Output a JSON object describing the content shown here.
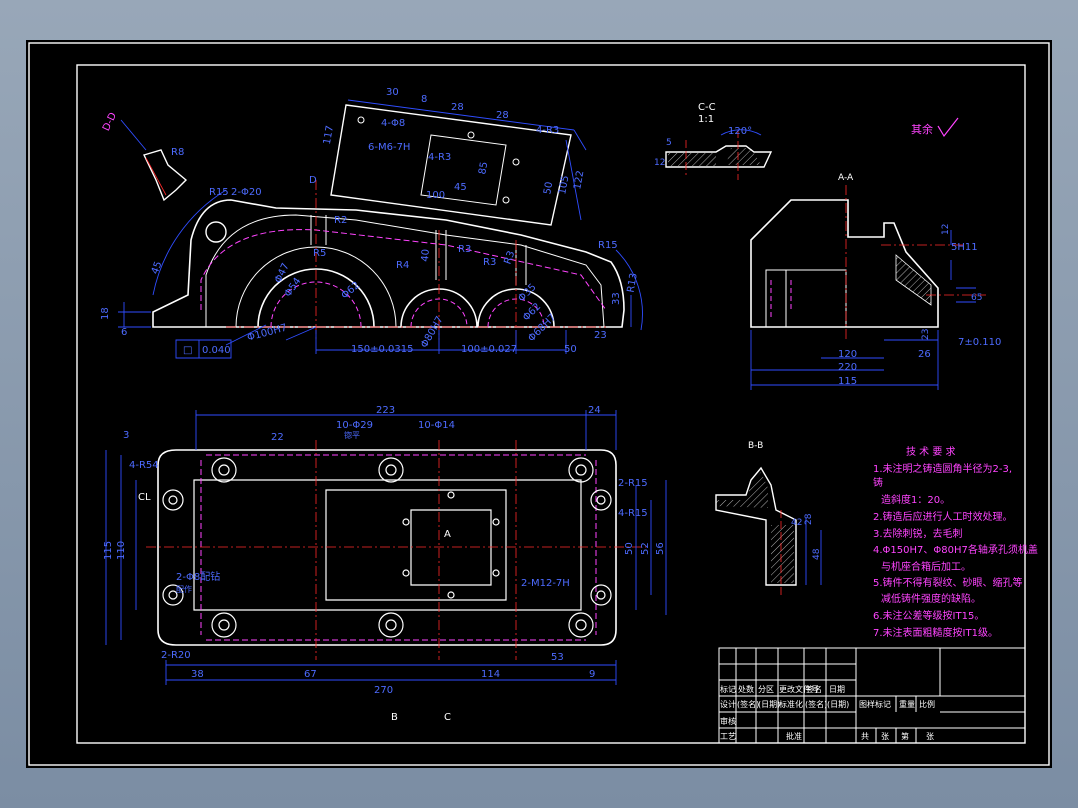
{
  "theme": {
    "outline": "#ffffff",
    "dimension": "#2f4dff",
    "centerline": "#ff2a2a",
    "hidden": "#ff44ff",
    "notes": "#ff44ff",
    "background": "#000000"
  },
  "front_view": {
    "dims": {
      "d30": "30",
      "d8": "8",
      "d28a": "28",
      "d28b": "28",
      "d117": "117",
      "holes_4_8": "4-Φ8",
      "holes_4_r3": "4-R3",
      "thread_6m6": "6-M6-7H",
      "holes_4_r3b": "4-R3",
      "d45": "45",
      "d100": "100",
      "d85": "85",
      "d122": "122",
      "d50": "50",
      "d105": "105",
      "r15a": "R15",
      "holes_2_20": "2-Φ20",
      "d45b": "45",
      "r8": "R8",
      "r2": "R2",
      "r5": "R5",
      "r3": "R3",
      "r3b": "R3",
      "r4": "R4",
      "r3c": "R3",
      "r15b": "R15",
      "r13": "R13",
      "d40": "40",
      "d33": "33",
      "d18": "18",
      "d6": "6",
      "d150": "150±0.0315",
      "d100b": "100±0.027",
      "d50b": "50",
      "d23": "23",
      "phi47": "Φ47",
      "phi54": "Φ54",
      "phi62": "Φ62",
      "phi100": "Φ100H7",
      "phi80": "Φ80H7",
      "phi68": "Φ68H7",
      "phi35": "Φ35",
      "phi62b": "Φ62",
      "flatness_sym": "□",
      "flatness": "0.040"
    },
    "section_dd": "D-D",
    "section_d": "D"
  },
  "section_cc": {
    "label": "C-C",
    "scale": "1:1",
    "angle": "120°",
    "dims": {
      "d12": "12",
      "d5": "5"
    }
  },
  "rest_roughness": "其余",
  "side_view": {
    "label": "A-A",
    "dims": {
      "d120": "120",
      "d220": "220",
      "d115": "115",
      "d26": "26",
      "tol": "7±0.110",
      "d5h11": "5H11",
      "d12": "12",
      "d23": "23",
      "d65": "65"
    }
  },
  "top_view": {
    "dims": {
      "d223": "223",
      "d24": "24",
      "d22": "22",
      "holes_10_29": "10-Φ29",
      "holes_10_14": "10-Φ14",
      "spot": "锪平",
      "holes_4_r54": "4-R54",
      "holes_2_r15": "2-R15",
      "holes_4_r15": "4-R15",
      "cl": "CL",
      "d115": "115",
      "d110": "110",
      "d3": "3",
      "d50": "50",
      "d52": "52",
      "d56": "56",
      "thread_2m8": "2-Φ8配钻",
      "ream": "配作",
      "thread_2m12": "2-M12-7H",
      "holes_2_r20": "2-R20",
      "d38": "38",
      "d67": "67",
      "d114": "114",
      "d53": "53",
      "d9": "9",
      "d270": "270",
      "sec_b": "B",
      "sec_c": "C",
      "sec_a": "A"
    }
  },
  "section_bb": {
    "label": "B-B",
    "dims": {
      "d28": "28",
      "d48": "48",
      "d42": "42"
    }
  },
  "tech_requirements": {
    "title": "技  术  要  求",
    "lines": [
      "1.未注明之铸造圆角半径为2-3,",
      "铸",
      "造斜度1：20。",
      "2.铸造后应进行人工时效处理。",
      "3.去除刺锐，去毛刺",
      "4.Φ150H7、Φ80H7各轴承孔须机盖",
      "与机座合箱后加工。",
      "5.铸件不得有裂纹、砂眼、缩孔等",
      "减低铸件强度的缺陷。",
      "6.未注公差等级按IT15。",
      "7.未注表面粗糙度按IT1级。"
    ]
  },
  "title_block": {
    "row_a": [
      "标记",
      "处数",
      "分区",
      "更改文件号",
      "签名",
      "日期"
    ],
    "row_b": [
      "设计",
      "(签名)",
      "(日期)",
      "标准化",
      "(签名)",
      "(日期)"
    ],
    "row_c": [
      "审核",
      "工艺",
      "",
      "批准"
    ],
    "extras": [
      "图样标记",
      "重量",
      "比例"
    ],
    "sheet": [
      "共",
      "张",
      "第",
      "张"
    ]
  }
}
